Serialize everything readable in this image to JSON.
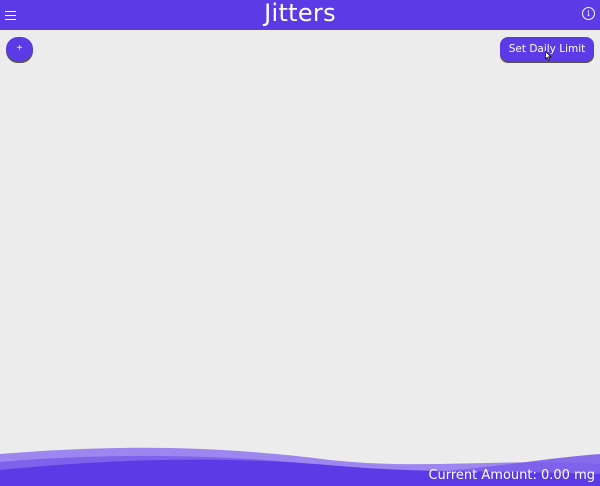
{
  "header": {
    "title": "Jitters",
    "menu_icon": "hamburger-menu-icon",
    "info_icon": "info-icon",
    "info_glyph": "i"
  },
  "toolbar": {
    "add_label": "+",
    "limit_label": "Set Daily Limit"
  },
  "footer": {
    "current_amount": "Current Amount: 0.00 mg"
  },
  "colors": {
    "accent": "#5b3be6",
    "wave_light": "#9d86f0",
    "background": "#ececec"
  }
}
